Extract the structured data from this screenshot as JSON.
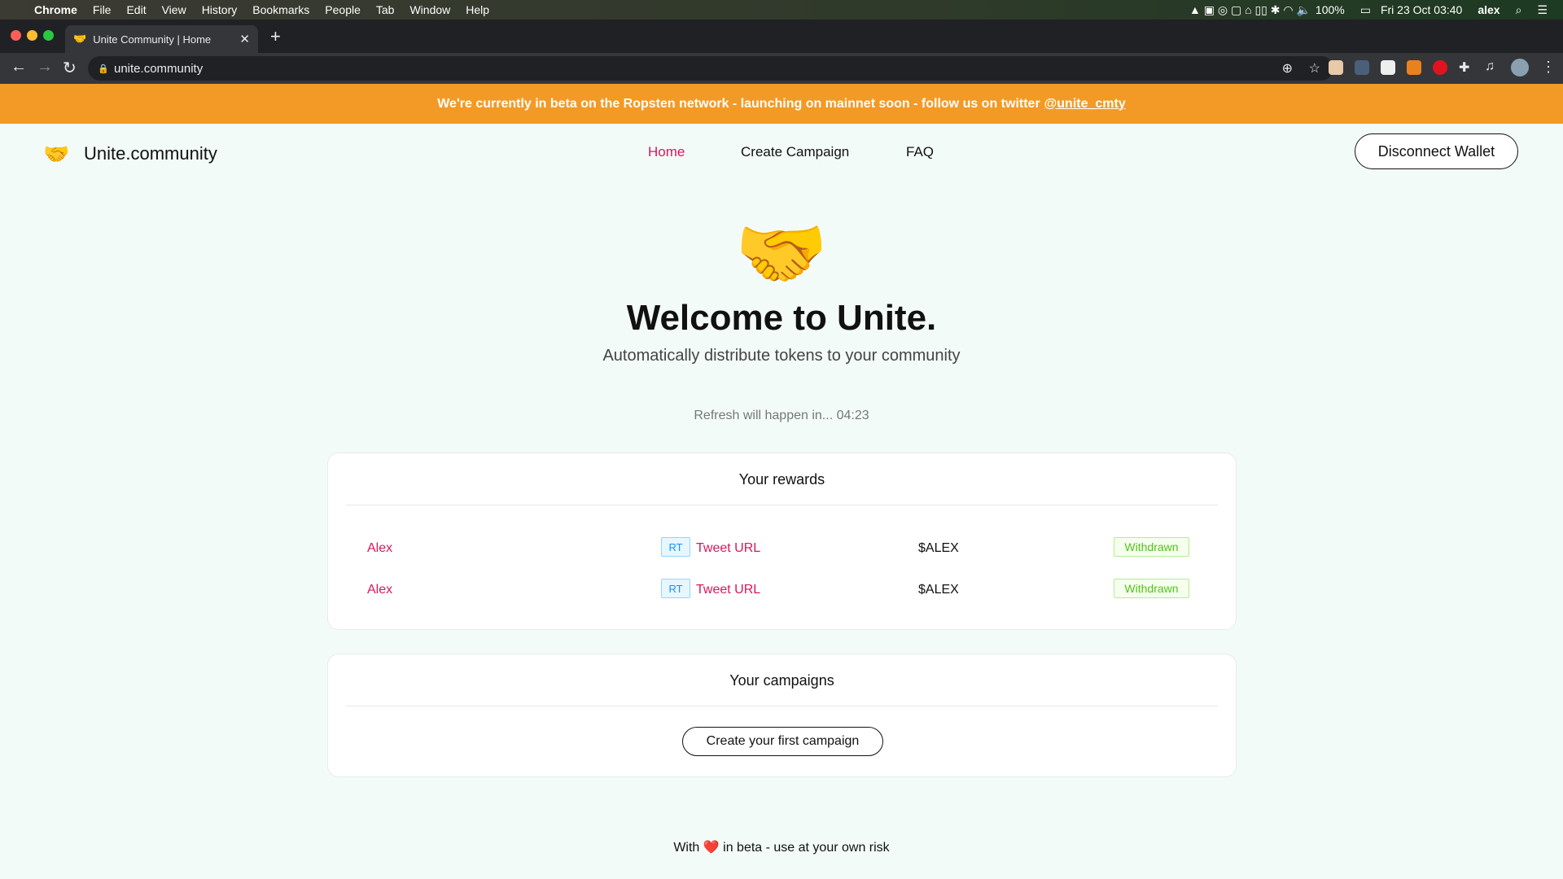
{
  "os_menu": {
    "apple": "",
    "items": [
      "Chrome",
      "File",
      "Edit",
      "View",
      "History",
      "Bookmarks",
      "People",
      "Tab",
      "Window",
      "Help"
    ],
    "battery": "100%",
    "datetime": "Fri 23 Oct  03:40",
    "user": "alex"
  },
  "browser": {
    "tab_title": "Unite Community | Home",
    "url": "unite.community"
  },
  "banner": {
    "text": "We're currently in beta on the Ropsten network - launching on mainnet soon - follow us on twitter",
    "link": "@unite_cmty"
  },
  "header": {
    "brand": "Unite.community",
    "nav": [
      "Home",
      "Create Campaign",
      "FAQ"
    ],
    "active": "Home",
    "disconnect": "Disconnect Wallet"
  },
  "hero": {
    "emoji": "🤝",
    "title": "Welcome to Unite.",
    "subtitle": "Automatically distribute tokens to your community",
    "refresh": "Refresh will happen in... 04:23"
  },
  "rewards": {
    "title": "Your rewards",
    "rows": [
      {
        "name": "Alex",
        "tag": "RT",
        "link": "Tweet URL",
        "token": "$ALEX",
        "status": "Withdrawn"
      },
      {
        "name": "Alex",
        "tag": "RT",
        "link": "Tweet URL",
        "token": "$ALEX",
        "status": "Withdrawn"
      }
    ]
  },
  "campaigns": {
    "title": "Your campaigns",
    "button": "Create your first campaign"
  },
  "footer": {
    "pre": "With",
    "heart": "❤️",
    "post": "in beta - use at your own risk"
  },
  "colors": {
    "banner": "#f39a26",
    "accent": "#d6185d",
    "status": "#52c41a"
  }
}
